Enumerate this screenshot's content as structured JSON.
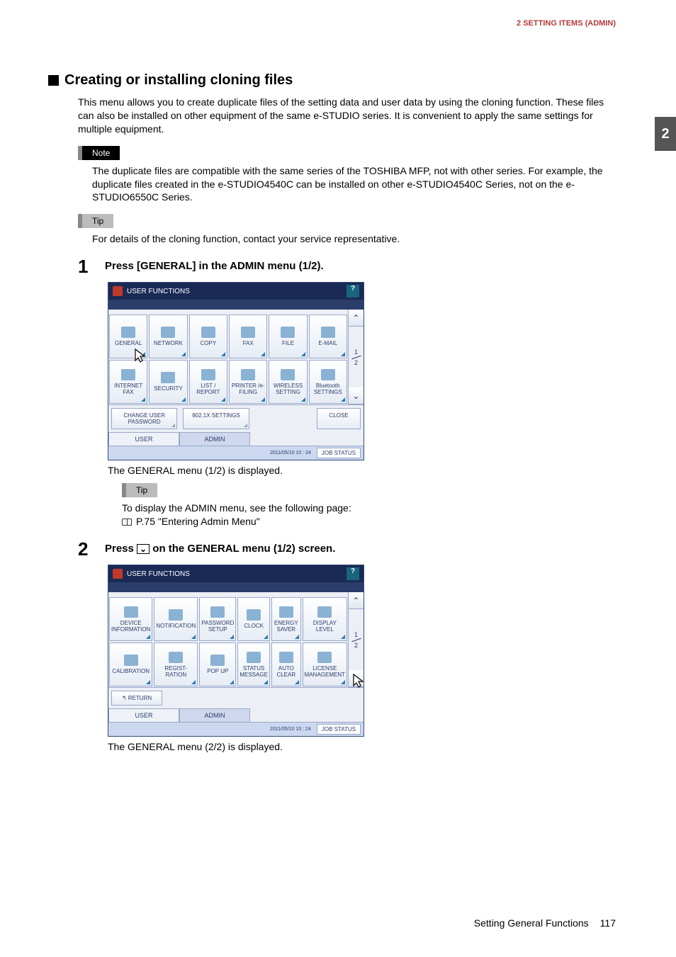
{
  "header": {
    "breadcrumb": "2 SETTING ITEMS (ADMIN)",
    "chapter_tab": "2"
  },
  "section": {
    "title": "Creating or installing cloning files",
    "intro": "This menu allows you to create duplicate files of the setting data and user data by using the cloning function. These files can also be installed on other equipment of the same e-STUDIO series. It is convenient to apply the same settings for multiple equipment."
  },
  "note": {
    "label": "Note",
    "body": "The duplicate files are compatible with the same series of the TOSHIBA MFP, not with other series. For example, the duplicate files created in the e-STUDIO4540C can be installed on other e-STUDIO4540C Series, not on the e-STUDIO6550C Series."
  },
  "tip1": {
    "label": "Tip",
    "body": "For details of the cloning function, contact your service representative."
  },
  "step1": {
    "num": "1",
    "text": "Press [GENERAL] in the ADMIN menu (1/2).",
    "after": "The GENERAL menu (1/2) is displayed."
  },
  "tip2": {
    "label": "Tip",
    "line1": "To display the ADMIN menu, see the following page:",
    "line2": "P.75 \"Entering Admin Menu\""
  },
  "step2": {
    "num": "2",
    "text_before": "Press ",
    "text_after": " on the GENERAL menu (1/2) screen.",
    "icon_glyph": "⌄",
    "after": "The GENERAL menu (2/2) is displayed."
  },
  "mfp_common": {
    "title": "USER FUNCTIONS",
    "help": "?",
    "page_indicator": {
      "current": "1",
      "total": "2"
    },
    "tabs": {
      "user": "USER",
      "admin": "ADMIN"
    },
    "timestamp": "2011/05/10\n10 : 24",
    "job_status": "JOB STATUS",
    "close": "CLOSE",
    "scroll_up": "⌃",
    "scroll_down": "⌄"
  },
  "mfp1": {
    "grid": [
      "GENERAL",
      "NETWORK",
      "COPY",
      "FAX",
      "FILE",
      "E-MAIL",
      "INTERNET FAX",
      "SECURITY",
      "LIST / REPORT",
      "PRINTER /e-FILING",
      "WIRELESS SETTING",
      "Bluetooth SETTINGS"
    ],
    "row2": [
      "CHANGE USER PASSWORD",
      "802.1X SETTINGS"
    ]
  },
  "mfp2": {
    "grid": [
      "DEVICE INFORMATION",
      "NOTIFICATION",
      "PASSWORD SETUP",
      "CLOCK",
      "ENERGY SAVER",
      "DISPLAY LEVEL",
      "CALIBRATION",
      "REGIST-RATION",
      "POP UP",
      "STATUS MESSAGE",
      "AUTO CLEAR",
      "LICENSE MANAGEMENT"
    ],
    "return": "RETURN"
  },
  "footer": {
    "section": "Setting General Functions",
    "page": "117"
  },
  "chart_data": null
}
